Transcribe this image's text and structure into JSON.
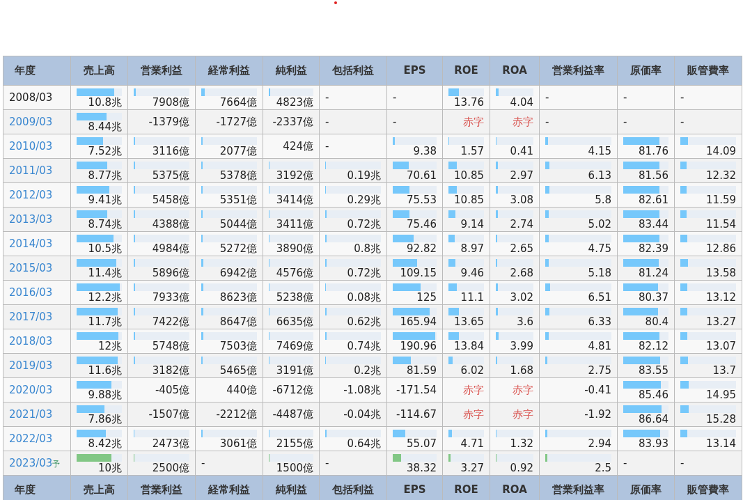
{
  "header": [
    "年度",
    "売上高",
    "営業利益",
    "経常利益",
    "純利益",
    "包括利益",
    "EPS",
    "ROE",
    "ROA",
    "営業利益率",
    "原価率",
    "販管費率"
  ],
  "rows": [
    {
      "year": "2008/03",
      "link": false,
      "forecast": false,
      "cells": [
        {
          "text": "10.8兆",
          "kind": "bar",
          "level": 0.86
        },
        {
          "text": "7908億",
          "kind": "bar",
          "level": 0.04
        },
        {
          "text": "7664億",
          "kind": "bar",
          "level": 0.07
        },
        {
          "text": "4823億",
          "kind": "bar",
          "level": 0.04
        },
        {
          "text": "-",
          "kind": "dash"
        },
        {
          "text": "-",
          "kind": "dash"
        },
        {
          "text": "13.76",
          "kind": "bar",
          "level": 0.3
        },
        {
          "text": "4.04",
          "kind": "bar",
          "level": 0.07
        },
        {
          "text": "-",
          "kind": "dash"
        },
        {
          "text": "-",
          "kind": "dash"
        },
        {
          "text": "-",
          "kind": "dash"
        }
      ]
    },
    {
      "year": "2009/03",
      "link": true,
      "forecast": false,
      "cells": [
        {
          "text": "8.44兆",
          "kind": "bar",
          "level": 0.68
        },
        {
          "text": "-1379億",
          "kind": "plain"
        },
        {
          "text": "-1727億",
          "kind": "plain"
        },
        {
          "text": "-2337億",
          "kind": "plain"
        },
        {
          "text": "-",
          "kind": "dash"
        },
        {
          "text": "-",
          "kind": "dash"
        },
        {
          "text": "赤字",
          "kind": "deficit"
        },
        {
          "text": "赤字",
          "kind": "deficit"
        },
        {
          "text": "-",
          "kind": "dash"
        },
        {
          "text": "-",
          "kind": "dash"
        },
        {
          "text": "-",
          "kind": "dash"
        }
      ]
    },
    {
      "year": "2010/03",
      "link": true,
      "forecast": false,
      "cells": [
        {
          "text": "7.52兆",
          "kind": "bar",
          "level": 0.6
        },
        {
          "text": "3116億",
          "kind": "bar",
          "level": 0.02
        },
        {
          "text": "2077億",
          "kind": "bar",
          "level": 0.02
        },
        {
          "text": "424億",
          "kind": "plain"
        },
        {
          "text": "-",
          "kind": "dash"
        },
        {
          "text": "9.38",
          "kind": "bar",
          "level": 0.05
        },
        {
          "text": "1.57",
          "kind": "bar",
          "level": 0.03
        },
        {
          "text": "0.41",
          "kind": "bar",
          "level": 0.01
        },
        {
          "text": "4.15",
          "kind": "bar",
          "level": 0.04
        },
        {
          "text": "81.76",
          "kind": "bar",
          "level": 0.82
        },
        {
          "text": "14.09",
          "kind": "bar",
          "level": 0.14
        }
      ]
    },
    {
      "year": "2011/03",
      "link": true,
      "forecast": false,
      "cells": [
        {
          "text": "8.77兆",
          "kind": "bar",
          "level": 0.7
        },
        {
          "text": "5375億",
          "kind": "bar",
          "level": 0.03
        },
        {
          "text": "5378億",
          "kind": "bar",
          "level": 0.03
        },
        {
          "text": "3192億",
          "kind": "bar",
          "level": 0.02
        },
        {
          "text": "0.19兆",
          "kind": "bar",
          "level": 0.01
        },
        {
          "text": "70.61",
          "kind": "bar",
          "level": 0.37
        },
        {
          "text": "10.85",
          "kind": "bar",
          "level": 0.24
        },
        {
          "text": "2.97",
          "kind": "bar",
          "level": 0.05
        },
        {
          "text": "6.13",
          "kind": "bar",
          "level": 0.06
        },
        {
          "text": "81.56",
          "kind": "bar",
          "level": 0.82
        },
        {
          "text": "12.32",
          "kind": "bar",
          "level": 0.12
        }
      ]
    },
    {
      "year": "2012/03",
      "link": true,
      "forecast": false,
      "cells": [
        {
          "text": "9.41兆",
          "kind": "bar",
          "level": 0.75
        },
        {
          "text": "5458億",
          "kind": "bar",
          "level": 0.03
        },
        {
          "text": "5351億",
          "kind": "bar",
          "level": 0.03
        },
        {
          "text": "3414億",
          "kind": "bar",
          "level": 0.02
        },
        {
          "text": "0.29兆",
          "kind": "bar",
          "level": 0.01
        },
        {
          "text": "75.53",
          "kind": "bar",
          "level": 0.4
        },
        {
          "text": "10.85",
          "kind": "bar",
          "level": 0.24
        },
        {
          "text": "3.08",
          "kind": "bar",
          "level": 0.05
        },
        {
          "text": "5.8",
          "kind": "bar",
          "level": 0.06
        },
        {
          "text": "82.61",
          "kind": "bar",
          "level": 0.83
        },
        {
          "text": "11.59",
          "kind": "bar",
          "level": 0.12
        }
      ]
    },
    {
      "year": "2013/03",
      "link": true,
      "forecast": false,
      "cells": [
        {
          "text": "8.74兆",
          "kind": "bar",
          "level": 0.7
        },
        {
          "text": "4388億",
          "kind": "bar",
          "level": 0.03
        },
        {
          "text": "5044億",
          "kind": "bar",
          "level": 0.03
        },
        {
          "text": "3411億",
          "kind": "bar",
          "level": 0.02
        },
        {
          "text": "0.72兆",
          "kind": "bar",
          "level": 0.03
        },
        {
          "text": "75.46",
          "kind": "bar",
          "level": 0.4
        },
        {
          "text": "9.14",
          "kind": "bar",
          "level": 0.2
        },
        {
          "text": "2.74",
          "kind": "bar",
          "level": 0.05
        },
        {
          "text": "5.02",
          "kind": "bar",
          "level": 0.05
        },
        {
          "text": "83.44",
          "kind": "bar",
          "level": 0.83
        },
        {
          "text": "11.54",
          "kind": "bar",
          "level": 0.12
        }
      ]
    },
    {
      "year": "2014/03",
      "link": true,
      "forecast": false,
      "cells": [
        {
          "text": "10.5兆",
          "kind": "bar",
          "level": 0.84
        },
        {
          "text": "4984億",
          "kind": "bar",
          "level": 0.03
        },
        {
          "text": "5272億",
          "kind": "bar",
          "level": 0.03
        },
        {
          "text": "3890億",
          "kind": "bar",
          "level": 0.02
        },
        {
          "text": "0.8兆",
          "kind": "bar",
          "level": 0.03
        },
        {
          "text": "92.82",
          "kind": "bar",
          "level": 0.49
        },
        {
          "text": "8.97",
          "kind": "bar",
          "level": 0.19
        },
        {
          "text": "2.65",
          "kind": "bar",
          "level": 0.04
        },
        {
          "text": "4.75",
          "kind": "bar",
          "level": 0.05
        },
        {
          "text": "82.39",
          "kind": "bar",
          "level": 0.82
        },
        {
          "text": "12.86",
          "kind": "bar",
          "level": 0.13
        }
      ]
    },
    {
      "year": "2015/03",
      "link": true,
      "forecast": false,
      "cells": [
        {
          "text": "11.4兆",
          "kind": "bar",
          "level": 0.91
        },
        {
          "text": "5896億",
          "kind": "bar",
          "level": 0.03
        },
        {
          "text": "6942億",
          "kind": "bar",
          "level": 0.04
        },
        {
          "text": "4576億",
          "kind": "bar",
          "level": 0.02
        },
        {
          "text": "0.72兆",
          "kind": "bar",
          "level": 0.03
        },
        {
          "text": "109.15",
          "kind": "bar",
          "level": 0.57
        },
        {
          "text": "9.46",
          "kind": "bar",
          "level": 0.21
        },
        {
          "text": "2.68",
          "kind": "bar",
          "level": 0.04
        },
        {
          "text": "5.18",
          "kind": "bar",
          "level": 0.05
        },
        {
          "text": "81.24",
          "kind": "bar",
          "level": 0.81
        },
        {
          "text": "13.58",
          "kind": "bar",
          "level": 0.14
        }
      ]
    },
    {
      "year": "2016/03",
      "link": true,
      "forecast": false,
      "cells": [
        {
          "text": "12.2兆",
          "kind": "bar",
          "level": 0.98
        },
        {
          "text": "7933億",
          "kind": "bar",
          "level": 0.03
        },
        {
          "text": "8623億",
          "kind": "bar",
          "level": 0.04
        },
        {
          "text": "5238億",
          "kind": "bar",
          "level": 0.02
        },
        {
          "text": "0.08兆",
          "kind": "bar",
          "level": 0.01
        },
        {
          "text": "125",
          "kind": "bar",
          "level": 0.65
        },
        {
          "text": "11.1",
          "kind": "bar",
          "level": 0.24
        },
        {
          "text": "3.02",
          "kind": "bar",
          "level": 0.05
        },
        {
          "text": "6.51",
          "kind": "bar",
          "level": 0.07
        },
        {
          "text": "80.37",
          "kind": "bar",
          "level": 0.8
        },
        {
          "text": "13.12",
          "kind": "bar",
          "level": 0.13
        }
      ]
    },
    {
      "year": "2017/03",
      "link": true,
      "forecast": false,
      "cells": [
        {
          "text": "11.7兆",
          "kind": "bar",
          "level": 0.94
        },
        {
          "text": "7422億",
          "kind": "bar",
          "level": 0.03
        },
        {
          "text": "8647億",
          "kind": "bar",
          "level": 0.04
        },
        {
          "text": "6635億",
          "kind": "bar",
          "level": 0.02
        },
        {
          "text": "0.62兆",
          "kind": "bar",
          "level": 0.03
        },
        {
          "text": "165.94",
          "kind": "bar",
          "level": 0.87
        },
        {
          "text": "13.65",
          "kind": "bar",
          "level": 0.3
        },
        {
          "text": "3.6",
          "kind": "bar",
          "level": 0.06
        },
        {
          "text": "6.33",
          "kind": "bar",
          "level": 0.06
        },
        {
          "text": "80.4",
          "kind": "bar",
          "level": 0.8
        },
        {
          "text": "13.27",
          "kind": "bar",
          "level": 0.13
        }
      ]
    },
    {
      "year": "2018/03",
      "link": true,
      "forecast": false,
      "cells": [
        {
          "text": "12兆",
          "kind": "bar",
          "level": 0.96
        },
        {
          "text": "5748億",
          "kind": "bar",
          "level": 0.03
        },
        {
          "text": "7503億",
          "kind": "bar",
          "level": 0.04
        },
        {
          "text": "7469億",
          "kind": "bar",
          "level": 0.02
        },
        {
          "text": "0.74兆",
          "kind": "bar",
          "level": 0.03
        },
        {
          "text": "190.96",
          "kind": "bar",
          "level": 1
        },
        {
          "text": "13.84",
          "kind": "bar",
          "level": 0.3
        },
        {
          "text": "3.99",
          "kind": "bar",
          "level": 0.07
        },
        {
          "text": "4.81",
          "kind": "bar",
          "level": 0.05
        },
        {
          "text": "82.12",
          "kind": "bar",
          "level": 0.82
        },
        {
          "text": "13.07",
          "kind": "bar",
          "level": 0.13
        }
      ]
    },
    {
      "year": "2019/03",
      "link": true,
      "forecast": false,
      "cells": [
        {
          "text": "11.6兆",
          "kind": "bar",
          "level": 0.93
        },
        {
          "text": "3182億",
          "kind": "bar",
          "level": 0.02
        },
        {
          "text": "5465億",
          "kind": "bar",
          "level": 0.03
        },
        {
          "text": "3191億",
          "kind": "bar",
          "level": 0.02
        },
        {
          "text": "0.2兆",
          "kind": "bar",
          "level": 0.01
        },
        {
          "text": "81.59",
          "kind": "bar",
          "level": 0.43
        },
        {
          "text": "6.02",
          "kind": "bar",
          "level": 0.13
        },
        {
          "text": "1.68",
          "kind": "bar",
          "level": 0.03
        },
        {
          "text": "2.75",
          "kind": "bar",
          "level": 0.03
        },
        {
          "text": "83.55",
          "kind": "bar",
          "level": 0.84
        },
        {
          "text": "13.7",
          "kind": "bar",
          "level": 0.14
        }
      ]
    },
    {
      "year": "2020/03",
      "link": true,
      "forecast": false,
      "cells": [
        {
          "text": "9.88兆",
          "kind": "bar",
          "level": 0.79
        },
        {
          "text": "-405億",
          "kind": "plain"
        },
        {
          "text": "440億",
          "kind": "plain"
        },
        {
          "text": "-6712億",
          "kind": "plain"
        },
        {
          "text": "-1.08兆",
          "kind": "plain"
        },
        {
          "text": "-171.54",
          "kind": "plain"
        },
        {
          "text": "赤字",
          "kind": "deficit"
        },
        {
          "text": "赤字",
          "kind": "deficit"
        },
        {
          "text": "-0.41",
          "kind": "plain"
        },
        {
          "text": "85.46",
          "kind": "bar",
          "level": 0.85
        },
        {
          "text": "14.95",
          "kind": "bar",
          "level": 0.15
        }
      ]
    },
    {
      "year": "2021/03",
      "link": true,
      "forecast": false,
      "cells": [
        {
          "text": "7.86兆",
          "kind": "bar",
          "level": 0.63
        },
        {
          "text": "-1507億",
          "kind": "plain"
        },
        {
          "text": "-2212億",
          "kind": "plain"
        },
        {
          "text": "-4487億",
          "kind": "plain"
        },
        {
          "text": "-0.04兆",
          "kind": "plain"
        },
        {
          "text": "-114.67",
          "kind": "plain"
        },
        {
          "text": "赤字",
          "kind": "deficit"
        },
        {
          "text": "赤字",
          "kind": "deficit"
        },
        {
          "text": "-1.92",
          "kind": "plain"
        },
        {
          "text": "86.64",
          "kind": "bar",
          "level": 0.87
        },
        {
          "text": "15.28",
          "kind": "bar",
          "level": 0.15
        }
      ]
    },
    {
      "year": "2022/03",
      "link": true,
      "forecast": false,
      "cells": [
        {
          "text": "8.42兆",
          "kind": "bar",
          "level": 0.67
        },
        {
          "text": "2473億",
          "kind": "bar",
          "level": 0.01
        },
        {
          "text": "3061億",
          "kind": "bar",
          "level": 0.02
        },
        {
          "text": "2155億",
          "kind": "bar",
          "level": 0.01
        },
        {
          "text": "0.64兆",
          "kind": "bar",
          "level": 0.03
        },
        {
          "text": "55.07",
          "kind": "bar",
          "level": 0.29
        },
        {
          "text": "4.71",
          "kind": "bar",
          "level": 0.1
        },
        {
          "text": "1.32",
          "kind": "bar",
          "level": 0.02
        },
        {
          "text": "2.94",
          "kind": "bar",
          "level": 0.03
        },
        {
          "text": "83.93",
          "kind": "bar",
          "level": 0.84
        },
        {
          "text": "13.14",
          "kind": "bar",
          "level": 0.13
        }
      ]
    },
    {
      "year": "2023/03",
      "mark": "予",
      "link": true,
      "forecast": true,
      "cells": [
        {
          "text": "10兆",
          "kind": "bar",
          "level": 0.8
        },
        {
          "text": "2500億",
          "kind": "bar",
          "level": 0.01
        },
        {
          "text": "-",
          "kind": "dash"
        },
        {
          "text": "1500億",
          "kind": "bar",
          "level": 0.01
        },
        {
          "text": "-",
          "kind": "dash"
        },
        {
          "text": "38.32",
          "kind": "bar",
          "level": 0.2
        },
        {
          "text": "3.27",
          "kind": "bar",
          "level": 0.07
        },
        {
          "text": "0.92",
          "kind": "bar",
          "level": 0.01
        },
        {
          "text": "2.5",
          "kind": "bar",
          "level": 0.03
        },
        {
          "text": "-",
          "kind": "dash"
        },
        {
          "text": "-",
          "kind": "dash"
        }
      ]
    }
  ],
  "footer_header": [
    "年度",
    "売上高",
    "営業利益",
    "経常利益",
    "純利益",
    "包括利益",
    "EPS",
    "ROE",
    "ROA",
    "営業利益率",
    "原価率",
    "販管費率"
  ]
}
